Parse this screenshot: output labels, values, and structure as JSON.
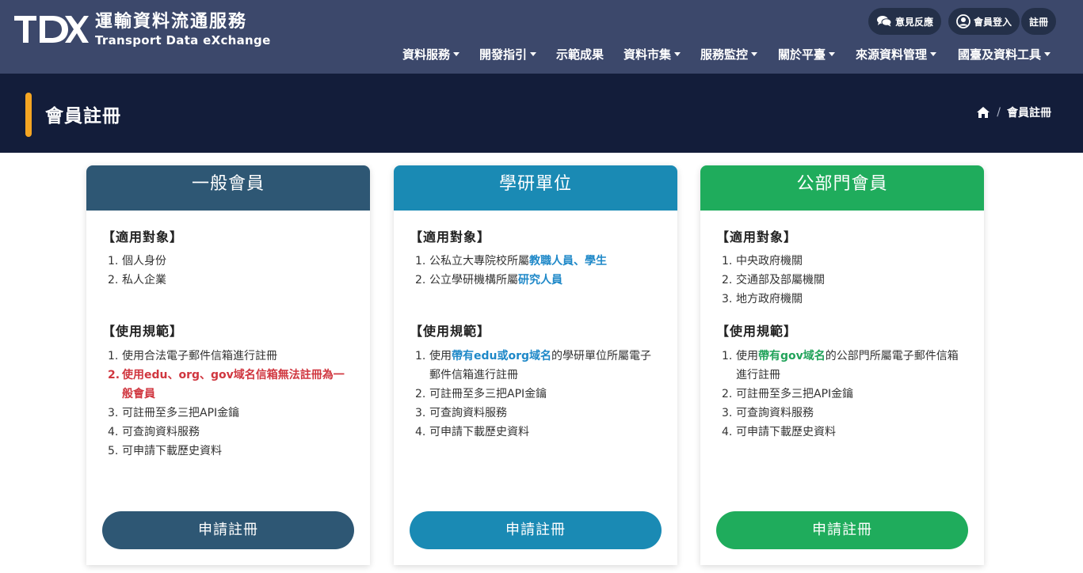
{
  "brand": {
    "title": "運輸資料流通服務",
    "subtitle": "Transport Data eXchange",
    "mark": "TDX"
  },
  "util": {
    "feedback": "意見反應",
    "login": "會員登入",
    "register": "註冊"
  },
  "nav": [
    {
      "label": "資料服務",
      "dropdown": true
    },
    {
      "label": "開發指引",
      "dropdown": true
    },
    {
      "label": "示範成果",
      "dropdown": false
    },
    {
      "label": "資料市集",
      "dropdown": true
    },
    {
      "label": "服務監控",
      "dropdown": true
    },
    {
      "label": "關於平臺",
      "dropdown": true
    },
    {
      "label": "來源資料管理",
      "dropdown": true
    },
    {
      "label": "國臺及資料工具",
      "dropdown": true
    }
  ],
  "page": {
    "title": "會員註冊",
    "breadcrumb_current": "會員註冊"
  },
  "colors": {
    "general": "#2e5774",
    "academic": "#1a8ab4",
    "public": "#1fac5c",
    "accent": "#f5a623"
  },
  "cards": [
    {
      "title": "一般會員",
      "target_title": "【適用對象】",
      "targets": [
        "個人身份",
        "私人企業"
      ],
      "rules_title": "【使用規範】",
      "rules": [
        {
          "text": "使用合法電子郵件信箱進行註冊"
        },
        {
          "text": "使用edu、org、gov域名信箱無法註冊為一般會員"
        },
        {
          "text": "可註冊至多三把API金鑰"
        },
        {
          "text": "可查詢資料服務"
        },
        {
          "text": "可申請下載歷史資料"
        }
      ],
      "button": "申請註冊"
    },
    {
      "title": "學研單位",
      "target_title": "【適用對象】",
      "targets_html": [
        {
          "pre": "公私立大專院校所屬",
          "hl": "教職人員、學生"
        },
        {
          "pre": "公立學研機構所屬",
          "hl": "研究人員"
        }
      ],
      "rules_title": "【使用規範】",
      "rules": [
        {
          "pre": "使用",
          "hl": "帶有edu或org域名",
          "post": "的學研單位所屬電子郵件信箱進行註冊"
        },
        {
          "text": "可註冊至多三把API金鑰"
        },
        {
          "text": "可查詢資料服務"
        },
        {
          "text": "可申請下載歷史資料"
        }
      ],
      "button": "申請註冊"
    },
    {
      "title": "公部門會員",
      "target_title": "【適用對象】",
      "targets": [
        "中央政府機關",
        "交通部及部屬機關",
        "地方政府機關"
      ],
      "rules_title": "【使用規範】",
      "rules": [
        {
          "pre": "使用",
          "hl": "帶有gov域名",
          "post": "的公部門所屬電子郵件信箱進行註冊"
        },
        {
          "text": "可註冊至多三把API金鑰"
        },
        {
          "text": "可查詢資料服務"
        },
        {
          "text": "可申請下載歷史資料"
        }
      ],
      "button": "申請註冊"
    }
  ]
}
